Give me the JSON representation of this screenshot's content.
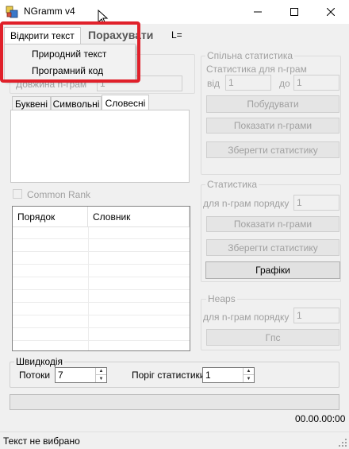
{
  "window": {
    "title": "NGramm v4"
  },
  "menu": {
    "open_text": "Відкрити текст",
    "calculate": "Порахувати",
    "length_label": "L=",
    "dropdown": [
      "Природний текст",
      "Програмний код"
    ]
  },
  "left": {
    "length_label": "Довжина n-грам",
    "length_value": "1",
    "tabs": [
      "Буквені",
      "Символьні",
      "Словесні"
    ],
    "active_tab": "Словесні",
    "common_rank_label": "Common Rank",
    "table": {
      "columns": [
        "Порядок",
        "Словник"
      ],
      "rows": []
    }
  },
  "common_stats": {
    "title": "Спільна статистика",
    "subtitle": "Статистика для n-грам",
    "from_label": "від",
    "from_value": "1",
    "to_label": "до",
    "to_value": "1",
    "build_button": "Побудувати",
    "show_button": "Показати n-грами",
    "save_button": "Зберегти статистику"
  },
  "stats": {
    "title": "Статистика",
    "order_label": "для n-грам порядку",
    "order_value": "1",
    "show_button": "Показати n-грами",
    "save_button": "Зберегти статистику",
    "charts_button": "Графіки"
  },
  "heaps": {
    "title": "Heaps",
    "order_label": "для n-грам порядку",
    "order_value": "1",
    "button": "Гпс"
  },
  "speed": {
    "title": "Швидкодія",
    "threads_label": "Потоки",
    "threads_value": "7",
    "threshold_label": "Поріг статистики",
    "threshold_value": "1"
  },
  "timer": "00.00.00:00",
  "status": "Текст не вибрано",
  "colors": {
    "highlight": "#e0202a",
    "window_bg": "#f0f0f0",
    "disabled_text": "#a0a0a0"
  }
}
